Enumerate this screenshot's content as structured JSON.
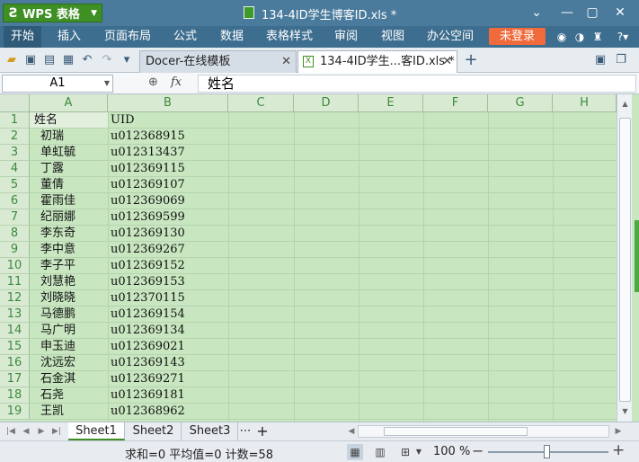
{
  "titlebar": {
    "app_label": "WPS 表格",
    "doc_title": "134-4ID学生博客ID.xls *",
    "controls": [
      "⌄",
      "—",
      "▢",
      "✕"
    ]
  },
  "menubar": {
    "items": [
      "开始",
      "插入",
      "页面布局",
      "公式",
      "数据",
      "表格样式",
      "审阅",
      "视图",
      "办公空间"
    ],
    "login_label": "未登录",
    "help_label": "?"
  },
  "tabs": [
    {
      "label": "Docer-在线模板"
    },
    {
      "label": "134-4ID学生...客ID.xls *"
    }
  ],
  "formulabar": {
    "cell_ref": "A1",
    "fx_label": "fx",
    "content": "姓名"
  },
  "columns": [
    "A",
    "B",
    "C",
    "D",
    "E",
    "F",
    "G",
    "H"
  ],
  "rows": [
    {
      "num": "1",
      "name": "姓名",
      "uid": "UID"
    },
    {
      "num": "2",
      "name": "初瑞",
      "uid": "u012368915"
    },
    {
      "num": "3",
      "name": "单虹毓",
      "uid": "u012313437"
    },
    {
      "num": "4",
      "name": "丁露",
      "uid": "u012369115"
    },
    {
      "num": "5",
      "name": "董倩",
      "uid": "u012369107"
    },
    {
      "num": "6",
      "name": "霍雨佳",
      "uid": "u012369069"
    },
    {
      "num": "7",
      "name": "纪丽娜",
      "uid": "u012369599"
    },
    {
      "num": "8",
      "name": "李东奇",
      "uid": "u012369130"
    },
    {
      "num": "9",
      "name": "李中意",
      "uid": "u012369267"
    },
    {
      "num": "10",
      "name": "李子平",
      "uid": "u012369152"
    },
    {
      "num": "11",
      "name": "刘慧艳",
      "uid": "u012369153"
    },
    {
      "num": "12",
      "name": "刘晓晓",
      "uid": "u012370115"
    },
    {
      "num": "13",
      "name": "马德鹏",
      "uid": "u012369154"
    },
    {
      "num": "14",
      "name": "马广明",
      "uid": "u012369134"
    },
    {
      "num": "15",
      "name": "申玉迪",
      "uid": "u012369021"
    },
    {
      "num": "16",
      "name": "沈远宏",
      "uid": "u012369143"
    },
    {
      "num": "17",
      "name": "石金淇",
      "uid": "u012369271"
    },
    {
      "num": "18",
      "name": "石尧",
      "uid": "u012369181"
    },
    {
      "num": "19",
      "name": "王凯",
      "uid": "u012368962"
    }
  ],
  "sheets": [
    "Sheet1",
    "Sheet2",
    "Sheet3"
  ],
  "status": {
    "stats": "求和=0  平均值=0  计数=58",
    "zoom": "100 %"
  }
}
